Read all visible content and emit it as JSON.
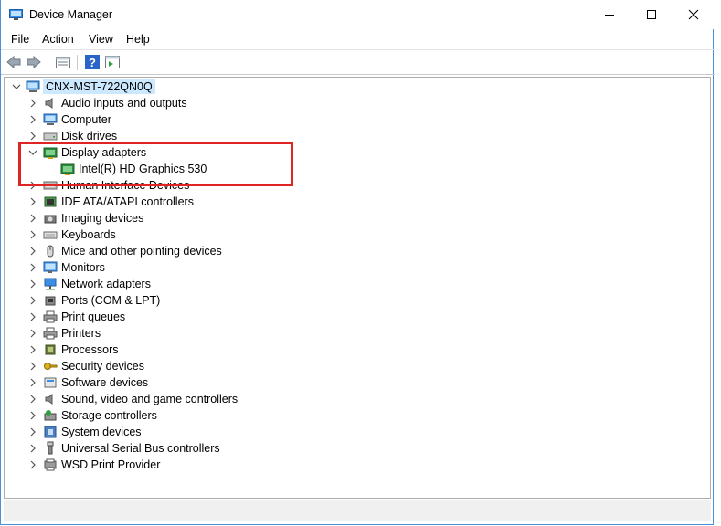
{
  "window": {
    "title": "Device Manager"
  },
  "menu": [
    "File",
    "Action",
    "View",
    "Help"
  ],
  "tree": {
    "root": "CNX-MST-722QN0Q",
    "categories": [
      {
        "label": "Audio inputs and outputs",
        "icon": "speaker-icon",
        "expanded": false
      },
      {
        "label": "Computer",
        "icon": "computer-icon",
        "expanded": false
      },
      {
        "label": "Disk drives",
        "icon": "disk-drive-icon",
        "expanded": false
      },
      {
        "label": "Display adapters",
        "icon": "display-adapter-icon",
        "expanded": true,
        "children": [
          "Intel(R) HD Graphics 530"
        ]
      },
      {
        "label": "Human Interface Devices",
        "icon": "hid-icon",
        "expanded": false
      },
      {
        "label": "IDE ATA/ATAPI controllers",
        "icon": "ide-controller-icon",
        "expanded": false
      },
      {
        "label": "Imaging devices",
        "icon": "camera-icon",
        "expanded": false
      },
      {
        "label": "Keyboards",
        "icon": "keyboard-icon",
        "expanded": false
      },
      {
        "label": "Mice and other pointing devices",
        "icon": "mouse-icon",
        "expanded": false
      },
      {
        "label": "Monitors",
        "icon": "monitor-icon",
        "expanded": false
      },
      {
        "label": "Network adapters",
        "icon": "network-icon",
        "expanded": false
      },
      {
        "label": "Ports (COM & LPT)",
        "icon": "port-icon",
        "expanded": false
      },
      {
        "label": "Print queues",
        "icon": "printer-icon",
        "expanded": false
      },
      {
        "label": "Printers",
        "icon": "printer-icon",
        "expanded": false
      },
      {
        "label": "Processors",
        "icon": "processor-icon",
        "expanded": false
      },
      {
        "label": "Security devices",
        "icon": "security-key-icon",
        "expanded": false
      },
      {
        "label": "Software devices",
        "icon": "software-device-icon",
        "expanded": false
      },
      {
        "label": "Sound, video and game controllers",
        "icon": "speaker-icon",
        "expanded": false
      },
      {
        "label": "Storage controllers",
        "icon": "storage-icon",
        "expanded": false
      },
      {
        "label": "System devices",
        "icon": "system-device-icon",
        "expanded": false
      },
      {
        "label": "Universal Serial Bus controllers",
        "icon": "usb-icon",
        "expanded": false
      },
      {
        "label": "WSD Print Provider",
        "icon": "wsd-icon",
        "expanded": false
      }
    ]
  },
  "colors": {
    "selection": "#cce8ff",
    "highlight_box": "#e02424",
    "window_border": "#4a90d9"
  }
}
